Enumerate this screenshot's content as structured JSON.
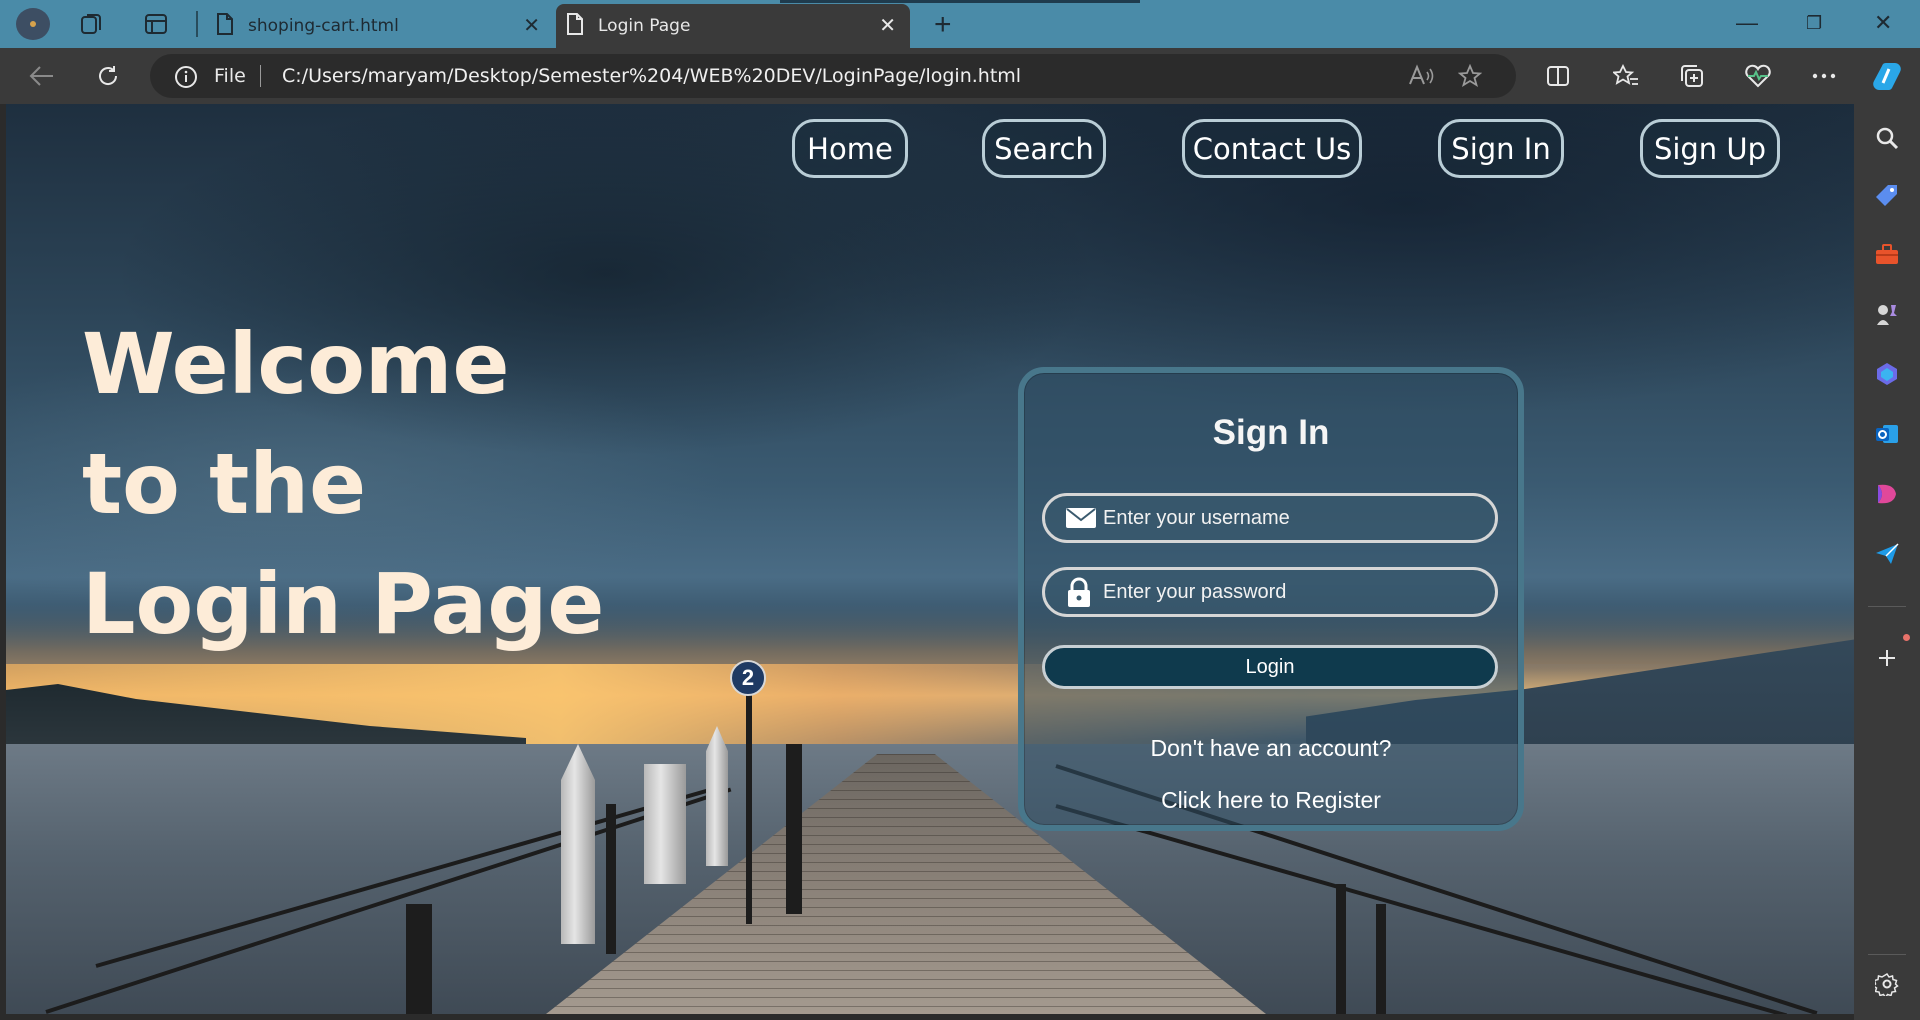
{
  "browser": {
    "tabs": [
      {
        "title": "shoping-cart.html",
        "active": false
      },
      {
        "title": "Login Page",
        "active": true
      }
    ],
    "address": {
      "scheme_label": "File",
      "url": "C:/Users/maryam/Desktop/Semester%204/WEB%20DEV/LoginPage/login.html"
    },
    "icons": {
      "profile": "profile-avatar",
      "workspaces": "workspaces-icon",
      "vertical_tabs": "vertical-tabs-icon",
      "back": "back-arrow-icon",
      "refresh": "refresh-icon",
      "info": "info-icon",
      "read_aloud": "read-aloud-icon",
      "favorite": "star-icon",
      "split_screen": "split-screen-icon",
      "favorites": "favorites-icon",
      "collections": "collections-icon",
      "browser_essentials": "heart-pulse-icon",
      "more": "more-dots-icon",
      "copilot": "copilot-icon"
    },
    "sidebar": [
      "search-icon",
      "tag-icon",
      "toolbox-icon",
      "games-icon",
      "copilot-app-icon",
      "outlook-icon",
      "drop-icon",
      "send-icon",
      "add-icon",
      "settings-icon"
    ]
  },
  "nav": {
    "items": [
      "Home",
      "Search",
      "Contact Us",
      "Sign In",
      "Sign Up"
    ]
  },
  "hero": {
    "line1": "Welcome",
    "line2": "to the",
    "line3": "Login Page"
  },
  "signin": {
    "title": "Sign In",
    "username_placeholder": "Enter your username",
    "password_placeholder": "Enter your password",
    "login_label": "Login",
    "no_account": "Don't have an account?",
    "register_link": "Click here to Register"
  },
  "scene": {
    "pier_sign_number": "2"
  },
  "colors": {
    "titlebar": "#4a8ba8",
    "chrome": "#3a3a3a",
    "hero_text": "#fdecd8",
    "login_button": "#0f3a4d",
    "card_border": "#48778b"
  }
}
